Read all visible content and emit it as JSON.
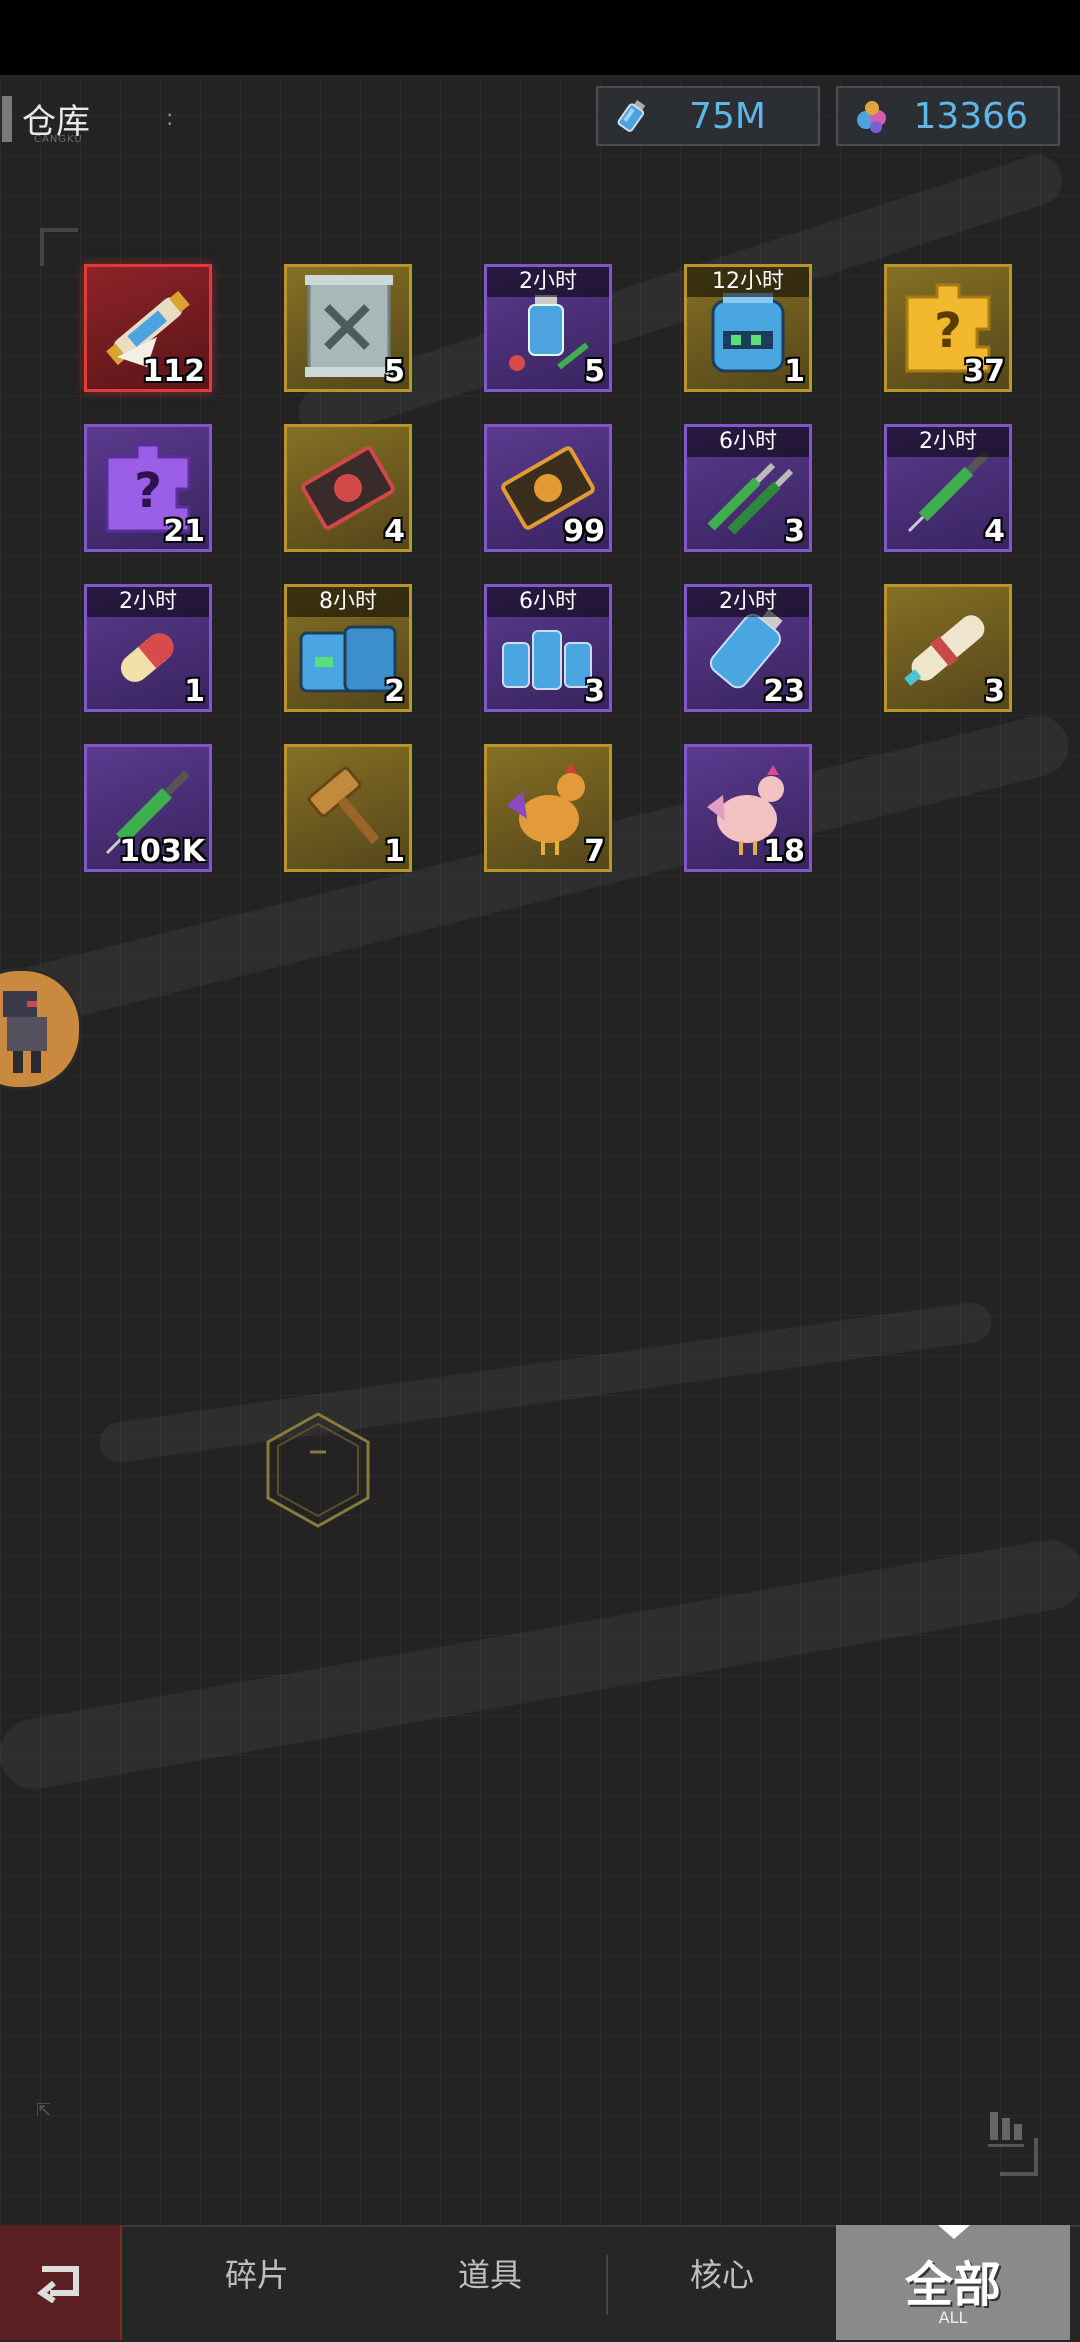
{
  "header": {
    "title": "仓库",
    "title_sub": "CANGKU",
    "dots": ":"
  },
  "currencies": [
    {
      "icon": "blue-potion-icon",
      "value": "75M"
    },
    {
      "icon": "gem-cluster-icon",
      "value": "13366"
    }
  ],
  "items": [
    {
      "icon": "rolled-scroll-icon",
      "rarity": "red",
      "qty": "112",
      "timer": ""
    },
    {
      "icon": "wrench-scroll-icon",
      "rarity": "gold",
      "qty": "5",
      "timer": ""
    },
    {
      "icon": "potion-and-syringe-icon",
      "rarity": "purple",
      "qty": "5",
      "timer": "2小时"
    },
    {
      "icon": "blue-container-icon",
      "rarity": "gold",
      "qty": "1",
      "timer": "12小时"
    },
    {
      "icon": "gold-mystery-puzzle-icon",
      "rarity": "gold",
      "qty": "37",
      "timer": ""
    },
    {
      "icon": "purple-mystery-puzzle-icon",
      "rarity": "purple",
      "qty": "21",
      "timer": ""
    },
    {
      "icon": "red-card-icon",
      "rarity": "gold",
      "qty": "4",
      "timer": ""
    },
    {
      "icon": "orange-card-icon",
      "rarity": "purple",
      "qty": "99",
      "timer": ""
    },
    {
      "icon": "green-syringes-icon",
      "rarity": "purple",
      "qty": "3",
      "timer": "6小时"
    },
    {
      "icon": "syringe-icon",
      "rarity": "purple",
      "qty": "4",
      "timer": "2小时"
    },
    {
      "icon": "pill-capsule-icon",
      "rarity": "purple",
      "qty": "1",
      "timer": "2小时"
    },
    {
      "icon": "twin-jars-icon",
      "rarity": "gold",
      "qty": "2",
      "timer": "8小时"
    },
    {
      "icon": "potion-bottles-icon",
      "rarity": "purple",
      "qty": "3",
      "timer": "6小时"
    },
    {
      "icon": "blue-bottle-icon",
      "rarity": "purple",
      "qty": "23",
      "timer": "2小时"
    },
    {
      "icon": "scroll-bundle-icon",
      "rarity": "gold",
      "qty": "3",
      "timer": ""
    },
    {
      "icon": "green-syringe-icon",
      "rarity": "purple",
      "qty": "103K",
      "timer": ""
    },
    {
      "icon": "gavel-icon",
      "rarity": "gold",
      "qty": "1",
      "timer": ""
    },
    {
      "icon": "rooster-icon",
      "rarity": "gold",
      "qty": "7",
      "timer": ""
    },
    {
      "icon": "hen-icon",
      "rarity": "purple",
      "qty": "18",
      "timer": ""
    }
  ],
  "tabs": {
    "fragments": "碎片",
    "props": "道具",
    "core": "核心",
    "all": "全部",
    "all_sub": "ALL"
  },
  "colors": {
    "gold_border": "#b8962a",
    "purple_border": "#8456cc",
    "red_border": "#e23a3a",
    "currency_text": "#5fb6e8"
  }
}
